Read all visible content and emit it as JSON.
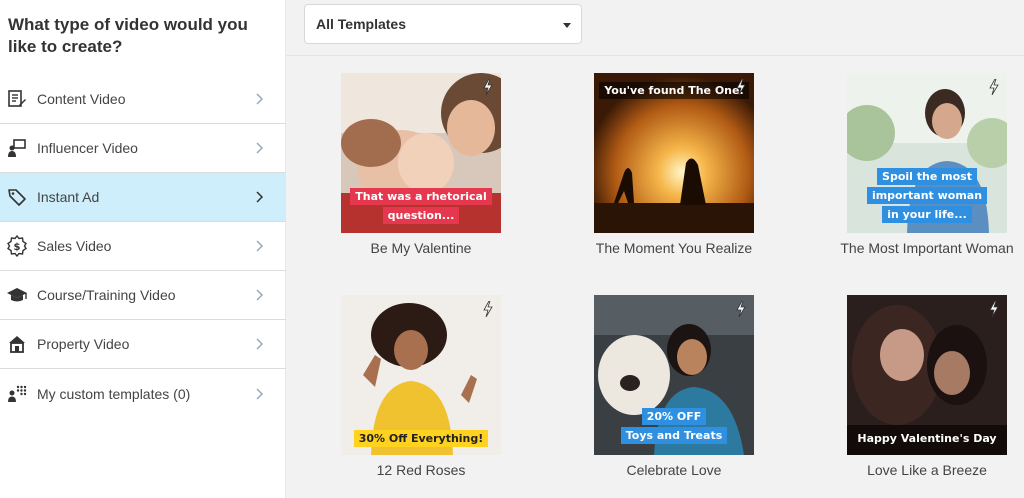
{
  "sidebar": {
    "title": "What type of video would you like to create?",
    "items": [
      {
        "label": "Content Video",
        "icon": "document-edit-icon",
        "active": false
      },
      {
        "label": "Influencer Video",
        "icon": "presenter-icon",
        "active": false
      },
      {
        "label": "Instant Ad",
        "icon": "tag-icon",
        "active": true
      },
      {
        "label": "Sales Video",
        "icon": "dollar-badge-icon",
        "active": false
      },
      {
        "label": "Course/Training Video",
        "icon": "graduation-cap-icon",
        "active": false
      },
      {
        "label": "Property Video",
        "icon": "house-icon",
        "active": false
      },
      {
        "label": "My custom templates (0)",
        "icon": "custom-templates-icon",
        "active": false
      }
    ]
  },
  "filter": {
    "selected": "All Templates"
  },
  "templates": [
    {
      "title": "Be My Valentine",
      "caption_lines": [
        "That was a rhetorical",
        "question..."
      ],
      "caption_highlight": "rhetorical"
    },
    {
      "title": "The Moment You Realize",
      "caption_lines": [
        "You've found The One."
      ],
      "caption_highlight": "The One."
    },
    {
      "title": "The Most Important Woman",
      "caption_lines": [
        "Spoil the most",
        "important woman",
        "in your life..."
      ]
    },
    {
      "title": "12 Red Roses",
      "caption_lines": [
        "30% Off Everything!"
      ],
      "caption_highlight": "Everything!"
    },
    {
      "title": "Celebrate Love",
      "caption_lines": [
        "20% OFF",
        "Toys and Treats"
      ]
    },
    {
      "title": "Love Like a Breeze",
      "caption_lines": [
        "Happy Valentine's Day"
      ],
      "caption_highlight": "Valentine's"
    }
  ],
  "colors": {
    "active_item_bg": "#cfeefb",
    "red_caption": "#e5384f",
    "blue_caption": "#2f8fe0",
    "yellow_caption": "#ffd21f"
  }
}
